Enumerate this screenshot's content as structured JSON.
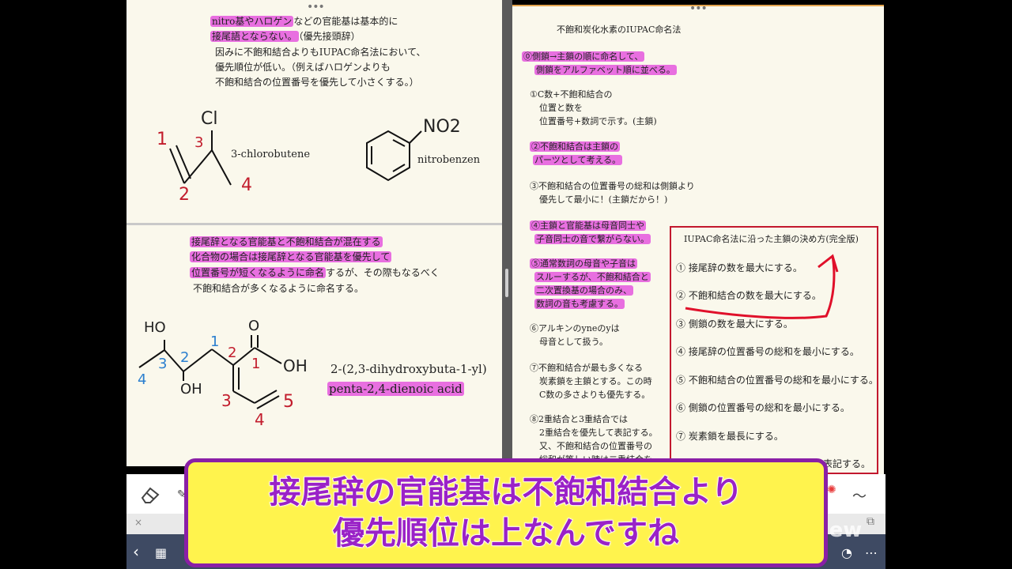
{
  "left": {
    "top_note": {
      "l1_hl": "nitro基やハロゲン",
      "l1_rest": "などの官能基は基本的に",
      "l2_hl": "接尾語とならない。",
      "l2_rest": "（優先接頭辞）",
      "l3": "因みに不飽和結合よりもIUPAC命名法において、",
      "l4": "優先順位が低い。（例えばハロゲンよりも",
      "l5": "不飽和結合の位置番号を優先して小さくする。）"
    },
    "mol1": {
      "name": "3-chlorobutene",
      "cl": "Cl",
      "n1": "1",
      "n2": "2",
      "n3": "3",
      "n4": "4"
    },
    "mol2": {
      "name": "nitrobenzen",
      "no2": "NO2"
    },
    "bottom_note": {
      "l1_hl": "接尾辞となる官能基と不飽和結合が混在する",
      "l2_hl": "化合物の場合は接尾辞となる官能基を優先して",
      "l3_hl": "位置番号が短くなるように命名",
      "l3_rest": "するが、その際もなるべく",
      "l4": "不飽和結合が多くなるように命名する。"
    },
    "mol3": {
      "name_l1": "2-(2,3-dihydroxybuta-1-yl)",
      "name_l2": "penta-2,4-dienoic acid",
      "ho": "HO",
      "oh_bottom": "OH",
      "oh_right": "OH",
      "o": "O",
      "red_2": "2",
      "red_1": "1",
      "red_3": "3",
      "red_4": "4",
      "red_5": "5",
      "blue_1": "1",
      "blue_2": "2",
      "blue_3": "3",
      "blue_4": "4"
    }
  },
  "right": {
    "title": "不飽和炭化水素のIUPAC命名法",
    "r0_l1": "⓪側鎖→主鎖の順に命名して、",
    "r0_l2": "側鎖をアルファベット順に並べる。",
    "r1_l1": "①C数+不飽和結合の",
    "r1_l2": "位置と数を",
    "r1_l3": "位置番号+数詞で示す。(主鎖)",
    "r2_l1": "②不飽和結合は主鎖の",
    "r2_l2": "パーツとして考える。",
    "r3_l1": "③不飽和結合の位置番号の総和は側鎖より",
    "r3_l2": "優先して最小に！(主鎖だから！)",
    "r4_l1": "④主鎖と官能基は母音同士や",
    "r4_l2": "子音同士の音で繋がらない。",
    "r5_l1": "⑤通常数詞の母音や子音は",
    "r5_l2": "スルーするが、不飽和結合と",
    "r5_l3": "二次置換基の場合のみ、",
    "r5_l4": "数詞の音も考慮する。",
    "r6_l1": "⑥アルキンのyneのyは",
    "r6_l2": "母音として扱う。",
    "r7_l1": "⑦不飽和結合が最も多くなる",
    "r7_l2": "炭素鎖を主鎖とする。この時",
    "r7_l3": "C数の多さよりも優先する。",
    "r8_l1": "⑧2重結合と3重結合では",
    "r8_l2": "2重結合を優先して表記する。",
    "r8_l3": "又、不飽和結合の位置番号の",
    "r8_l4": "総和が等しい時は二重結合を",
    "box": {
      "title": "IUPAC命名法に沿った主鎖の決め方(完全版)",
      "rules": [
        "① 接尾辞の数を最大にする。",
        "② 不飽和結合の数を最大にする。",
        "③ 側鎖の数を最大にする。",
        "④ 接尾辞の位置番号の総和を最小にする。",
        "⑤ 不飽和結合の位置番号の総和を最小にする。",
        "⑥ 側鎖の位置番号の総和を最小にする。",
        "⑦ 炭素鎖を最長にする。"
      ],
      "tail": "表記する。"
    }
  },
  "caption": {
    "line1": "接尾辞の官能基は不飽和結合より",
    "line2": "優先順位は上なんですね"
  },
  "toolbar": {
    "eraser_icon": "eraser-icon",
    "tab_close": "×",
    "watermark": "View"
  },
  "colors": {
    "highlight": "#e86fe0",
    "ink_red": "#c21c2c",
    "ink_blue": "#2b7fcf",
    "caption_bg": "#fff34d",
    "caption_border": "#8a1fa6",
    "caption_text": "#9a22c7"
  }
}
